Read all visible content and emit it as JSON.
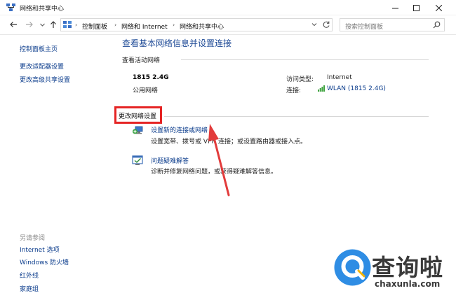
{
  "window": {
    "title": "网络和共享中心"
  },
  "address": {
    "breadcrumbs": [
      "控制面板",
      "网络和 Internet",
      "网络和共享中心"
    ],
    "search_placeholder": "搜索控制面板"
  },
  "sidebar": {
    "links": [
      "控制面板主页",
      "更改适配器设置",
      "更改高级共享设置"
    ],
    "see_also_title": "另请参阅",
    "see_also": [
      "Internet 选项",
      "Windows 防火墙",
      "红外线",
      "家庭组"
    ]
  },
  "main": {
    "title": "查看基本网络信息并设置连接",
    "active_title": "查看活动网络",
    "network_name": "1815 2.4G",
    "network_type": "公用网络",
    "access_type_label": "访问类型:",
    "access_type_value": "Internet",
    "connection_label": "连接:",
    "connection_value": "WLAN (1815 2.4G)",
    "change_title": "更改网络设置",
    "tasks": [
      {
        "link": "设置新的连接或网络",
        "desc": "设置宽带、拨号或 VPN 连接；或设置路由器或接入点。"
      },
      {
        "link": "问题疑难解答",
        "desc": "诊断并修复网络问题，或获得疑难解答信息。"
      }
    ]
  },
  "watermark": {
    "brand": "查询啦",
    "url": "chaxunla.com"
  },
  "colors": {
    "link": "#0b3c8c",
    "title_blue": "#1e4a96",
    "highlight_red": "#e52424",
    "arrow_red": "#e23b3b",
    "watermark_blue": "#2f8de4"
  }
}
